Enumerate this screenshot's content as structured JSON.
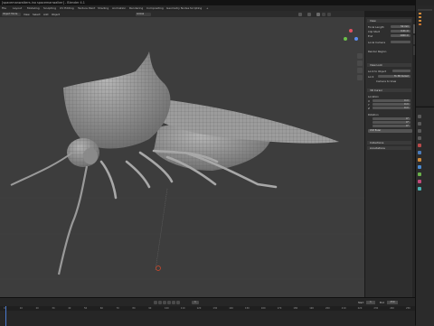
{
  "titlebar": {
    "text": "[spacemanwalkers.ino spacemanwalker] - Blender 4.1"
  },
  "menu": {
    "items": [
      "File",
      "Layout",
      "Modeling",
      "Sculpting",
      "UV Editing",
      "Texture Paint",
      "Shading",
      "Animation",
      "Rendering",
      "Compositing",
      "Geometry Nodes",
      "Scripting",
      "+"
    ]
  },
  "header3d": {
    "mode": "Object Mode",
    "view": "View",
    "select": "Select",
    "add": "Add",
    "object": "Object",
    "transform": "Global"
  },
  "npanel": {
    "view_section": "View",
    "focal_label": "Focal Length",
    "focal_value": "50 mm",
    "clip_label": "Clip Start",
    "clip_value": "0.01 m",
    "end_label": "End",
    "end_value": "1000 m",
    "local_camera": "Local Camera",
    "render_region": "Render Region",
    "view_lock": "View Lock",
    "lock_object": "Lock to Object",
    "lock_label": "Lock",
    "lock_value": "To 3D Cursor",
    "camera_to_view": "Camera to View",
    "cursor_section": "3D Cursor",
    "location_label": "Location",
    "x_label": "X",
    "x_value": "0 m",
    "y_label": "Y",
    "y_value": "0 m",
    "z_label": "Z",
    "z_value": "0 m",
    "rotation_label": "Rotation",
    "rx_value": "0°",
    "ry_value": "0°",
    "rz_value": "0°",
    "rotation_mode": "XYZ Euler",
    "collections": "Collections",
    "annotations": "Annotations"
  },
  "timeline": {
    "ticks": [
      "0",
      "10",
      "20",
      "30",
      "40",
      "50",
      "60",
      "70",
      "80",
      "90",
      "100",
      "110",
      "120",
      "130",
      "140",
      "150",
      "160",
      "170",
      "180",
      "190",
      "200",
      "210",
      "220",
      "230",
      "240",
      "250"
    ],
    "start_label": "Start",
    "start_value": "1",
    "end_label": "End",
    "end_value": "250",
    "current_frame": "1"
  }
}
